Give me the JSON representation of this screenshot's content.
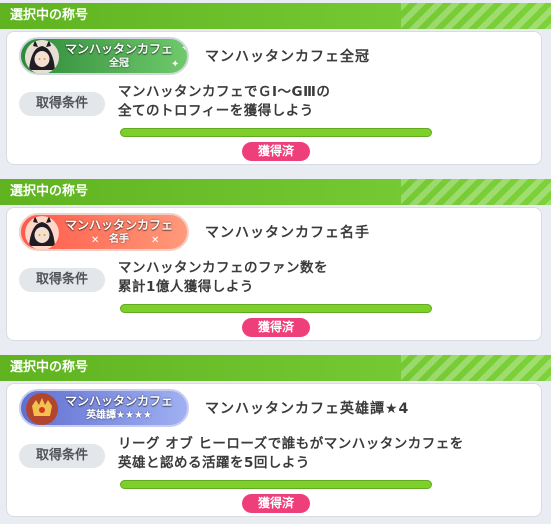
{
  "sections": [
    {
      "header": "選択中の称号",
      "badge": {
        "name": "マンハッタンカフェ",
        "sub": "全冠",
        "colors": [
          "#2e7d32",
          "#66bb6a"
        ]
      },
      "title": "マンハッタンカフェ全冠",
      "condition_label": "取得条件",
      "condition_lines": [
        "マンハッタンカフェでＧⅠ～GⅢの",
        "全てのトロフィーを獲得しよう"
      ],
      "progress": 1.0,
      "status": "獲得済"
    },
    {
      "header": "選択中の称号",
      "badge": {
        "name": "マンハッタンカフェ",
        "sub": "名手",
        "colors": [
          "#ff6e5a",
          "#ff9a7a"
        ]
      },
      "title": "マンハッタンカフェ名手",
      "condition_label": "取得条件",
      "condition_lines": [
        "マンハッタンカフェのファン数を",
        "累計1億人獲得しよう"
      ],
      "progress": 1.0,
      "status": "獲得済"
    },
    {
      "header": "選択中の称号",
      "badge": {
        "name": "マンハッタンカフェ",
        "sub": "英雄譚★★★★",
        "colors": [
          "#6a78d8",
          "#9aa8f0"
        ]
      },
      "title": "マンハッタンカフェ英雄譚★4",
      "condition_label": "取得条件",
      "condition_lines": [
        "リーグ オブ ヒーローズで誰もがマンハッタンカフェを",
        "英雄と認める活躍を5回しよう"
      ],
      "progress": 1.0,
      "status": "獲得済"
    }
  ],
  "colors": {
    "header": "#6cc32b",
    "status": "#ee3f7a",
    "progress": "#7fcf2c"
  }
}
